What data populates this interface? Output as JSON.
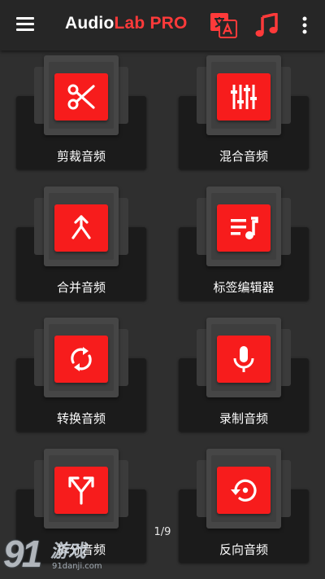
{
  "app_bar": {
    "title_part1": "Audio",
    "title_part2": "Lab PRO",
    "menu_icon": "hamburger-menu-icon",
    "translate_icon": "translate-icon",
    "music_icon": "music-note-icon",
    "more_icon": "more-vert-icon"
  },
  "tiles": [
    {
      "label": "剪裁音频",
      "icon": "scissors-icon"
    },
    {
      "label": "混合音频",
      "icon": "mixer-sliders-icon"
    },
    {
      "label": "合并音频",
      "icon": "merge-icon"
    },
    {
      "label": "标签编辑器",
      "icon": "playlist-music-icon"
    },
    {
      "label": "转换音频",
      "icon": "convert-cycle-icon"
    },
    {
      "label": "录制音频",
      "icon": "microphone-icon"
    },
    {
      "label": "拆分音频",
      "icon": "split-arrows-icon"
    },
    {
      "label": "反向音频",
      "icon": "reverse-history-icon"
    }
  ],
  "pagination": {
    "text": "1/9"
  },
  "watermark": {
    "brand": "91",
    "game": "游戏",
    "url": "91danji.com"
  },
  "colors": {
    "accent": "#f71c1c",
    "background": "#2f2f2f",
    "app_bar": "#262626",
    "tile_base": "#1b1b1b"
  }
}
